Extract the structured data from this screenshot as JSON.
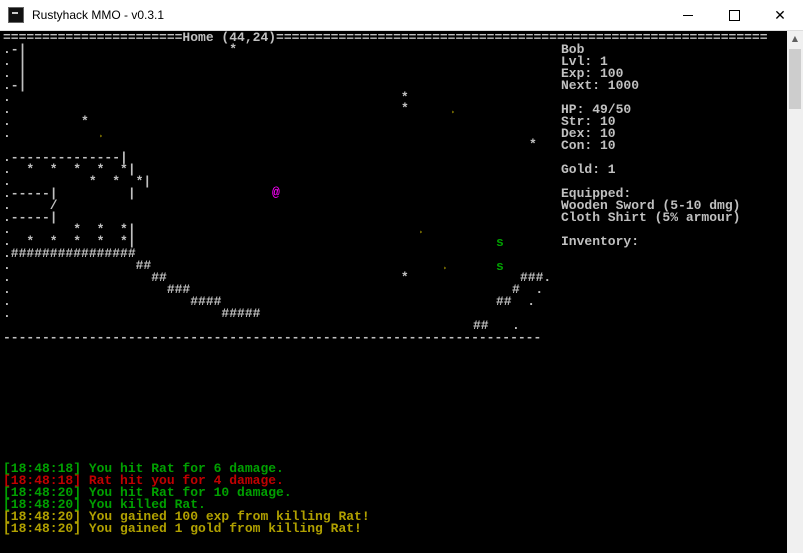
{
  "window": {
    "title": "Rustyhack MMO - v0.3.1",
    "minimize": "",
    "maximize": "",
    "close": "✕"
  },
  "map": {
    "header": "=======================Home (44,24)===============================================================",
    "footer": "---------------------------------------------------------------------",
    "rows": [
      ".-|                          *                                ",
      ". |                                                           ",
      ". |                                                           ",
      ".-|                                                           ",
      ".                                                  *          ",
      ".                                                             ",
      ".         *                                                   ",
      ".                                                             ",
      ".--------------|                                              ",
      ".  *  *  *  *  *|                                             ",
      ".          *  *  *|                                           ",
      ".-----|         |                                             ",
      ".     /                                                       ",
      ".-----|                                                       ",
      ".        *  *  *|                                             ",
      ".  *  *  *  *  *|                                             ",
      ".################                                             ",
      ".                ##                                           ",
      ".                  ##                              *          ",
      ".                    ###                                      ",
      ".                       ####                                  ",
      ".                           #####                             "
    ],
    "right_rows": [
      "###.",
      "#  .",
      "##  .",
      "##   ."
    ],
    "player": "@",
    "player_color": "#ff00ff",
    "entities": [
      {
        "glyph": "*",
        "color": "#c0c0c0"
      },
      {
        "glyph": "˒",
        "color": "#b0a000"
      },
      {
        "glyph": "*",
        "color": "#c0c0c0"
      },
      {
        "glyph": "˒",
        "color": "#b0a000"
      },
      {
        "glyph": "s",
        "color": "#00a000"
      },
      {
        "glyph": "s",
        "color": "#00a000"
      },
      {
        "glyph": "˒",
        "color": "#b0a000"
      },
      {
        "glyph": "˒",
        "color": "#b0a000"
      }
    ]
  },
  "sidebar": {
    "name": "Bob",
    "level": "Lvl: 1",
    "exp": "Exp: 100",
    "next": "Next: 1000",
    "hp": "HP: 49/50",
    "str": "Str: 10",
    "dex": "Dex: 10",
    "con": "Con: 10",
    "gold": "Gold: 1",
    "equipped_label": "Equipped:",
    "weapon": "Wooden Sword (5-10 dmg)",
    "armour": "Cloth Shirt (5% armour)",
    "inventory_label": "Inventory:"
  },
  "log": [
    {
      "text": "[18:48:18] You hit Rat for 6 damage.",
      "color": "#00a000"
    },
    {
      "text": "[18:48:18] Rat hit you for 4 damage.",
      "color": "#c00000"
    },
    {
      "text": "[18:48:20] You hit Rat for 10 damage.",
      "color": "#00a000"
    },
    {
      "text": "[18:48:20] You killed Rat.",
      "color": "#00a000"
    },
    {
      "text": "[18:48:20] You gained 100 exp from killing Rat!",
      "color": "#b0a000"
    },
    {
      "text": "[18:48:20] You gained 1 gold from killing Rat!",
      "color": "#b0a000"
    }
  ]
}
